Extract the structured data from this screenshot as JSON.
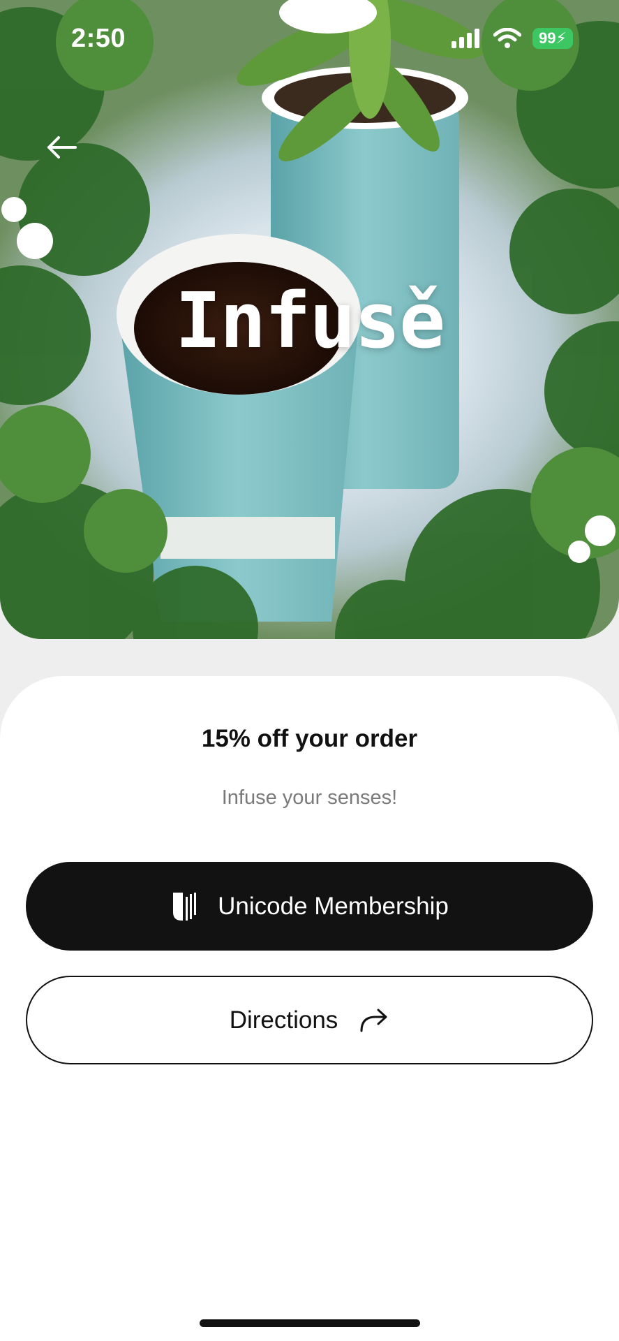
{
  "status_bar": {
    "time": "2:50",
    "battery": "99"
  },
  "hero": {
    "brand": "Infusě"
  },
  "offer": {
    "title": "15% off your order",
    "subtitle": "Infuse your senses!"
  },
  "buttons": {
    "membership_label": "Unicode Membership",
    "directions_label": "Directions"
  },
  "colors": {
    "primary_button_bg": "#121212",
    "battery_green": "#3cc763",
    "subtitle_gray": "#7a7a7a"
  },
  "icons": [
    "back-arrow-icon",
    "signal-icon",
    "wifi-icon",
    "battery-icon",
    "unicode-logo-icon",
    "share-arrow-icon"
  ]
}
